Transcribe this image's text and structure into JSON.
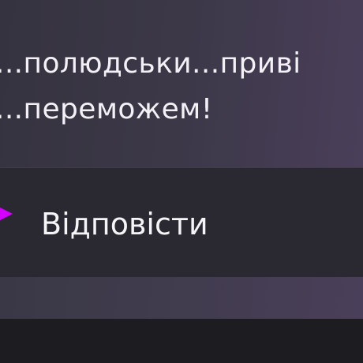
{
  "notification": {
    "message_lines": [
      "...полюдськи...приві",
      "...переможем!"
    ]
  },
  "actions": {
    "reply_label": "Відповісти",
    "reply_icon": "reply-arrow-icon",
    "accent_color": "#d400ff"
  }
}
